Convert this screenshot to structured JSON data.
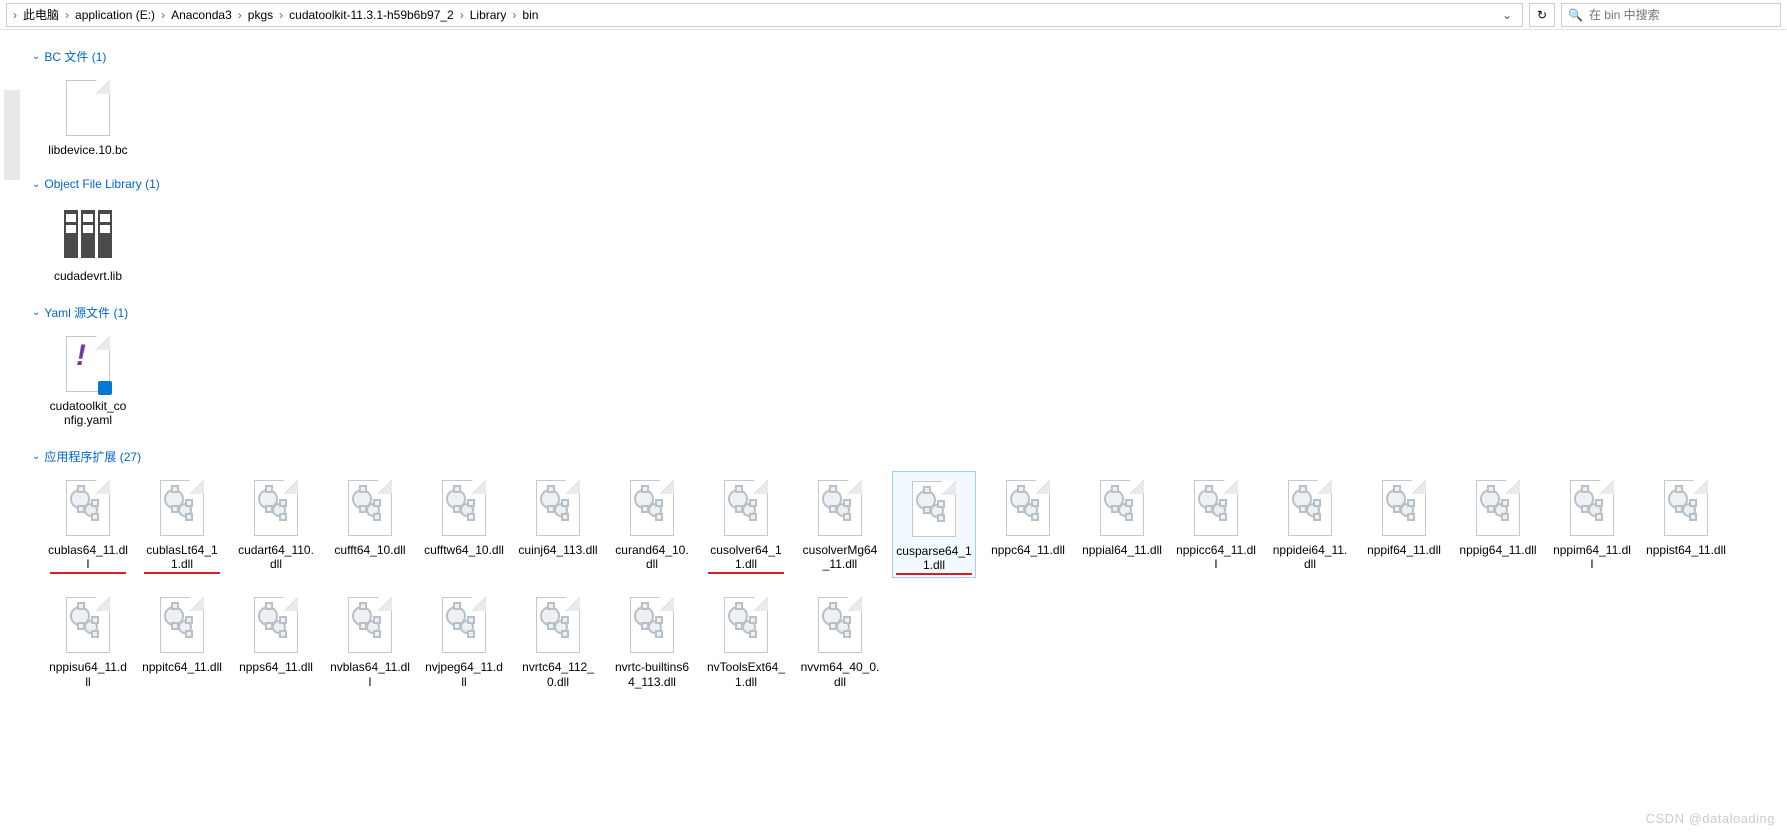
{
  "breadcrumbs": [
    "此电脑",
    "application (E:)",
    "Anaconda3",
    "pkgs",
    "cudatoolkit-11.3.1-h59b6b97_2",
    "Library",
    "bin"
  ],
  "search": {
    "placeholder": "在 bin 中搜索"
  },
  "groups": [
    {
      "title": "BC 文件 (1)",
      "items": [
        {
          "name": "libdevice.10.bc",
          "type": "page"
        }
      ]
    },
    {
      "title": "Object File Library (1)",
      "items": [
        {
          "name": "cudadevrt.lib",
          "type": "lib"
        }
      ]
    },
    {
      "title": "Yaml 源文件 (1)",
      "items": [
        {
          "name": "cudatoolkit_config.yaml",
          "type": "yaml"
        }
      ]
    },
    {
      "title": "应用程序扩展 (27)",
      "items": [
        {
          "name": "cublas64_11.dll",
          "type": "dll",
          "underline": true
        },
        {
          "name": "cublasLt64_11.dll",
          "type": "dll",
          "underline": true
        },
        {
          "name": "cudart64_110.dll",
          "type": "dll"
        },
        {
          "name": "cufft64_10.dll",
          "type": "dll"
        },
        {
          "name": "cufftw64_10.dll",
          "type": "dll"
        },
        {
          "name": "cuinj64_113.dll",
          "type": "dll"
        },
        {
          "name": "curand64_10.dll",
          "type": "dll"
        },
        {
          "name": "cusolver64_11.dll",
          "type": "dll",
          "underline": true
        },
        {
          "name": "cusolverMg64_11.dll",
          "type": "dll"
        },
        {
          "name": "cusparse64_11.dll",
          "type": "dll",
          "selected": true,
          "underline": true
        },
        {
          "name": "nppc64_11.dll",
          "type": "dll"
        },
        {
          "name": "nppial64_11.dll",
          "type": "dll"
        },
        {
          "name": "nppicc64_11.dll",
          "type": "dll"
        },
        {
          "name": "nppidei64_11.dll",
          "type": "dll"
        },
        {
          "name": "nppif64_11.dll",
          "type": "dll"
        },
        {
          "name": "nppig64_11.dll",
          "type": "dll"
        },
        {
          "name": "nppim64_11.dll",
          "type": "dll"
        },
        {
          "name": "nppist64_11.dll",
          "type": "dll"
        },
        {
          "name": "nppisu64_11.dll",
          "type": "dll"
        },
        {
          "name": "nppitc64_11.dll",
          "type": "dll"
        },
        {
          "name": "npps64_11.dll",
          "type": "dll"
        },
        {
          "name": "nvblas64_11.dll",
          "type": "dll"
        },
        {
          "name": "nvjpeg64_11.dll",
          "type": "dll"
        },
        {
          "name": "nvrtc64_112_0.dll",
          "type": "dll"
        },
        {
          "name": "nvrtc-builtins64_113.dll",
          "type": "dll"
        },
        {
          "name": "nvToolsExt64_1.dll",
          "type": "dll"
        },
        {
          "name": "nvvm64_40_0.dll",
          "type": "dll"
        }
      ]
    }
  ],
  "watermark": "CSDN @dataloading"
}
